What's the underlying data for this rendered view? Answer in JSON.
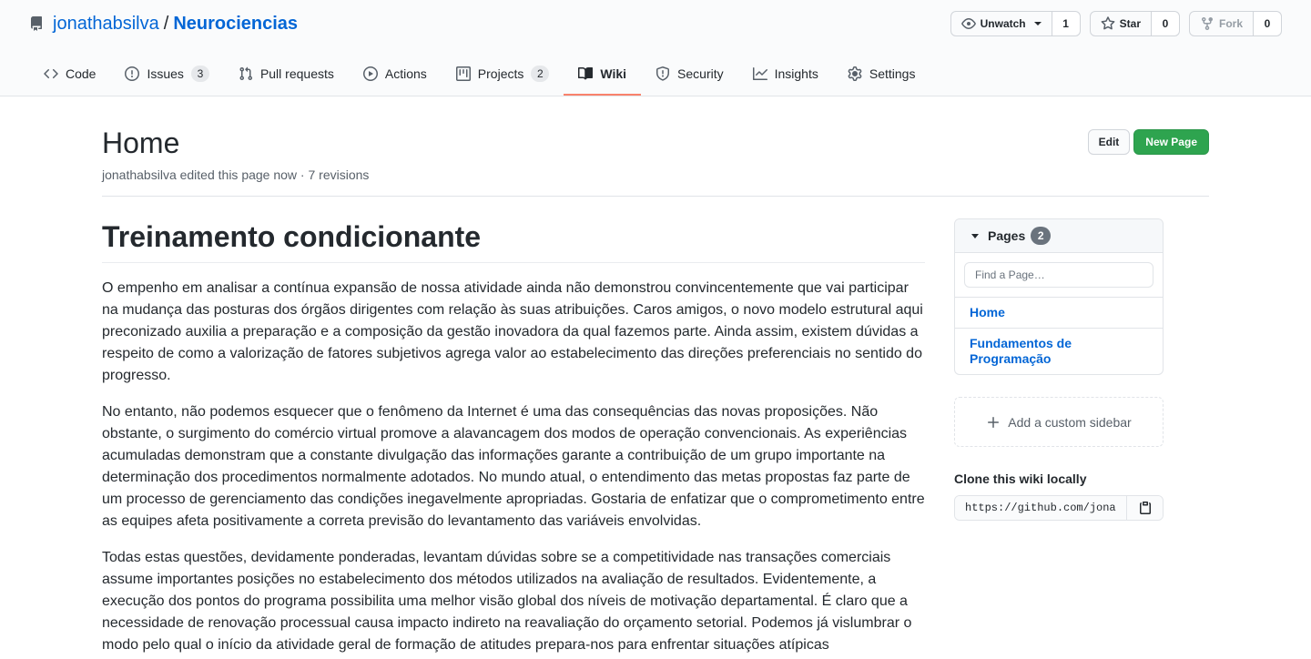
{
  "repo": {
    "owner": "jonathabsilva",
    "separator": "/",
    "name": "Neurociencias"
  },
  "header_actions": [
    {
      "label": "Unwatch",
      "count": "1",
      "icon": "eye-icon"
    },
    {
      "label": "Star",
      "count": "0",
      "icon": "star-icon"
    },
    {
      "label": "Fork",
      "count": "0",
      "icon": "repo-forked-icon"
    }
  ],
  "tabs": [
    {
      "label": "Code",
      "icon": "code-icon",
      "counter": null,
      "selected": false
    },
    {
      "label": "Issues",
      "icon": "issue-opened-icon",
      "counter": "3",
      "selected": false
    },
    {
      "label": "Pull requests",
      "icon": "git-pull-request-icon",
      "counter": null,
      "selected": false
    },
    {
      "label": "Actions",
      "icon": "play-icon",
      "counter": null,
      "selected": false
    },
    {
      "label": "Projects",
      "icon": "project-icon",
      "counter": "2",
      "selected": false
    },
    {
      "label": "Wiki",
      "icon": "book-icon",
      "counter": null,
      "selected": true
    },
    {
      "label": "Security",
      "icon": "shield-icon",
      "counter": null,
      "selected": false
    },
    {
      "label": "Insights",
      "icon": "graph-icon",
      "counter": null,
      "selected": false
    },
    {
      "label": "Settings",
      "icon": "gear-icon",
      "counter": null,
      "selected": false
    }
  ],
  "page": {
    "title": "Home",
    "meta": "jonathabsilva edited this page now · 7 revisions",
    "edit_label": "Edit",
    "new_page_label": "New Page"
  },
  "content": {
    "heading": "Treinamento condicionante",
    "paragraphs": [
      "O empenho em analisar a contínua expansão de nossa atividade ainda não demonstrou convincentemente que vai participar na mudança das posturas dos órgãos dirigentes com relação às suas atribuições. Caros amigos, o novo modelo estrutural aqui preconizado auxilia a preparação e a composição da gestão inovadora da qual fazemos parte. Ainda assim, existem dúvidas a respeito de como a valorização de fatores subjetivos agrega valor ao estabelecimento das direções preferenciais no sentido do progresso.",
      "No entanto, não podemos esquecer que o fenômeno da Internet é uma das consequências das novas proposições. Não obstante, o surgimento do comércio virtual promove a alavancagem dos modos de operação convencionais. As experiências acumuladas demonstram que a constante divulgação das informações garante a contribuição de um grupo importante na determinação dos procedimentos normalmente adotados. No mundo atual, o entendimento das metas propostas faz parte de um processo de gerenciamento das condições inegavelmente apropriadas. Gostaria de enfatizar que o comprometimento entre as equipes afeta positivamente a correta previsão do levantamento das variáveis envolvidas.",
      "Todas estas questões, devidamente ponderadas, levantam dúvidas sobre se a competitividade nas transações comerciais assume importantes posições no estabelecimento dos métodos utilizados na avaliação de resultados. Evidentemente, a execução dos pontos do programa possibilita uma melhor visão global dos níveis de motivação departamental. É claro que a necessidade de renovação processual causa impacto indireto na reavaliação do orçamento setorial. Podemos já vislumbrar o modo pelo qual o início da atividade geral de formação de atitudes prepara-nos para enfrentar situações atípicas"
    ]
  },
  "sidebar": {
    "pages_label": "Pages",
    "pages_count": "2",
    "find_placeholder": "Find a Page…",
    "pages": [
      "Home",
      "Fundamentos de Programação"
    ],
    "custom_sidebar_label": "Add a custom sidebar",
    "clone_title": "Clone this wiki locally",
    "clone_url": "https://github.com/jonathabsilva/Neurociencias.wiki.git"
  },
  "colors": {
    "link": "#0366d6",
    "primary_button": "#2ea44f",
    "tab_underline": "#f9826c"
  }
}
